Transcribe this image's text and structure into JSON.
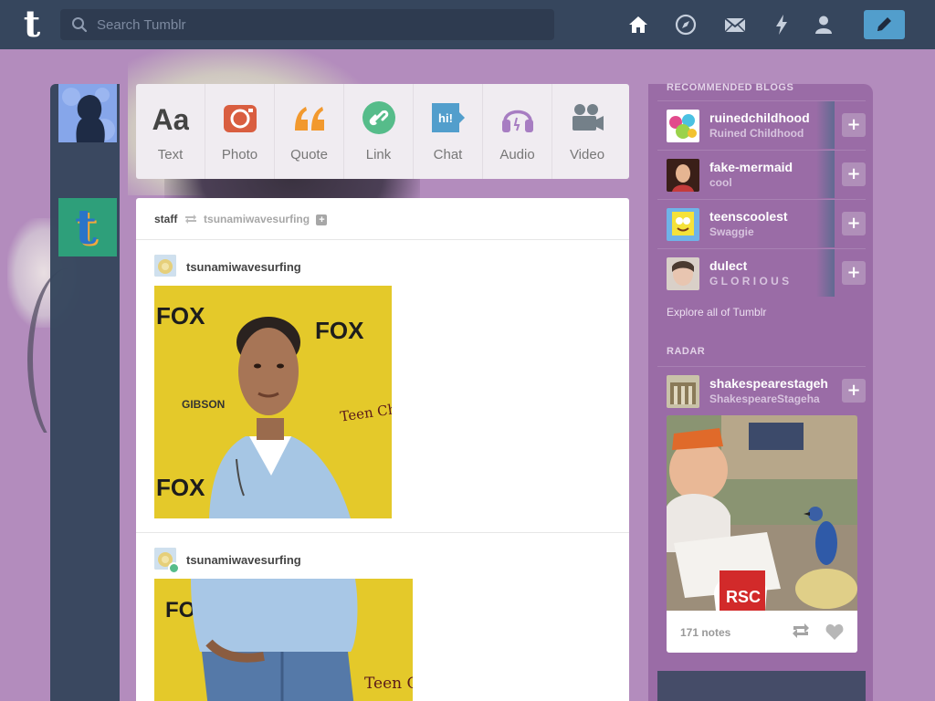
{
  "topbar": {
    "logo": "t",
    "search_placeholder": "Search Tumblr",
    "icons": [
      "home-icon",
      "explore-compass-icon",
      "inbox-mail-icon",
      "activity-lightning-icon",
      "account-person-icon",
      "compose-pencil-icon"
    ],
    "colors": {
      "bar": "#36465d",
      "compose": "#529ecc"
    }
  },
  "composer": {
    "types": [
      {
        "label": "Text",
        "icon": "text-aa-icon"
      },
      {
        "label": "Photo",
        "icon": "camera-icon"
      },
      {
        "label": "Quote",
        "icon": "quote-icon"
      },
      {
        "label": "Link",
        "icon": "link-icon"
      },
      {
        "label": "Chat",
        "icon": "chat-bubble-icon"
      },
      {
        "label": "Audio",
        "icon": "headphones-icon"
      },
      {
        "label": "Video",
        "icon": "video-camera-icon"
      }
    ],
    "text_glyph": "Aa",
    "chat_glyph": "hi!"
  },
  "dashboard": {
    "reblog_header": {
      "source": "staff",
      "target": "tsunamiwavesurfing",
      "plus": "+"
    },
    "posts": [
      {
        "user": "tsunamiwavesurfing",
        "reblogged": false
      },
      {
        "user": "tsunamiwavesurfing",
        "reblogged": true
      }
    ],
    "photo_sign_words": [
      "FOX",
      "FOX",
      "FOX",
      "FOX",
      "GIBSON",
      "Teen Choice Awards",
      "Teen Choice"
    ]
  },
  "sidebar": {
    "recommended_title": "RECOMMENDED BLOGS",
    "blogs": [
      {
        "name": "ruinedchildhood",
        "subtitle": "Ruined Childhood"
      },
      {
        "name": "fake-mermaid",
        "subtitle": "cool"
      },
      {
        "name": "teenscoolest",
        "subtitle": "Swaggie"
      },
      {
        "name": "dulect",
        "subtitle": "G L O R I O U S"
      }
    ],
    "follow_glyph": "+",
    "explore_link": "Explore all of Tumblr",
    "radar_title": "RADAR",
    "radar": {
      "name": "shakespearestageh",
      "subtitle": "ShakespeareStageha",
      "notes": "171 notes",
      "mug_text": "RSC"
    }
  }
}
